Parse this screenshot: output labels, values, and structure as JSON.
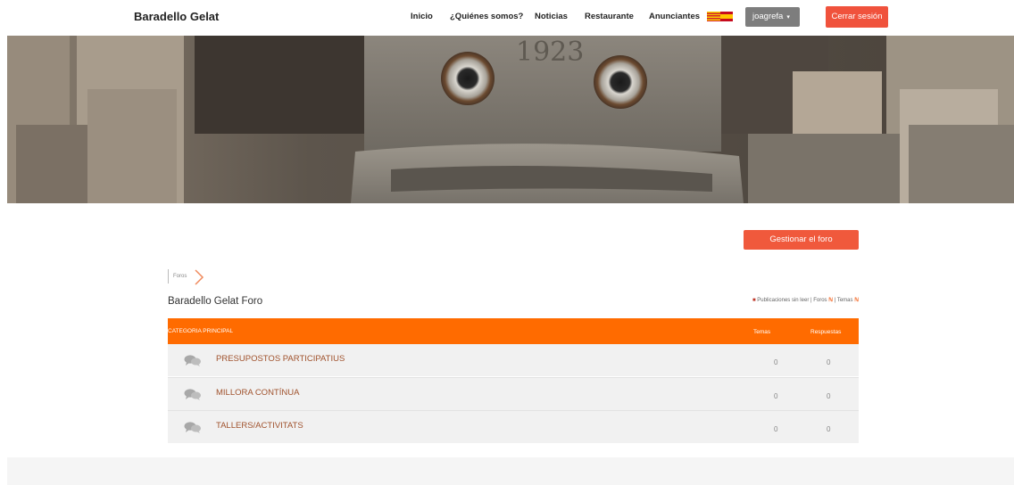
{
  "brand": "Baradello Gelat",
  "nav": {
    "inicio": "Inicio",
    "quienes": "¿Quiénes somos?",
    "noticias": "Noticias",
    "restaurante": "Restaurante",
    "anunciantes": "Anunciantes"
  },
  "user": {
    "name": "joagrefa",
    "caret": "▾"
  },
  "logout_label": "Cerrar sesión",
  "manage_label": "Gestionar el foro",
  "breadcrumb": {
    "item": "Foros"
  },
  "forum": {
    "title": "Baradello Gelat Foro",
    "links": {
      "unread": "Publicaciones sin leer",
      "sep1": "|",
      "foros": "Foros",
      "sep2": "|",
      "temas": "Temas"
    }
  },
  "table": {
    "category": "CATEGORIA PRINCIPAL",
    "col_temas": "Temas",
    "col_respuestas": "Respuestas",
    "rows": [
      {
        "label": "PRESUPOSTOS PARTICIPATIUS",
        "temas": "0",
        "respuestas": "0"
      },
      {
        "label": "MILLORA CONTÍNUA",
        "temas": "0",
        "respuestas": "0"
      },
      {
        "label": "TALLERS/ACTIVITATS",
        "temas": "0",
        "respuestas": "0"
      }
    ]
  },
  "colors": {
    "accent_orange": "#ff6b00",
    "button_red": "#f0523c",
    "row_bg": "#f1f1f1",
    "link_brown": "#a0522d"
  },
  "icons": [
    "flag-icon",
    "chevron-right-icon",
    "book-icon",
    "rss-icon",
    "chat-bubbles-icon"
  ]
}
